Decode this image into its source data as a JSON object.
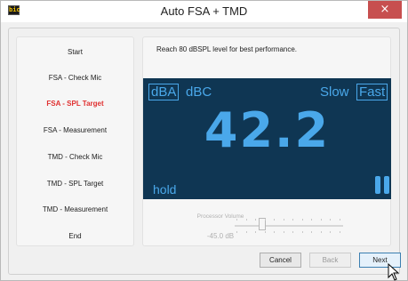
{
  "window": {
    "title": "Auto FSA + TMD",
    "app_icon_text": "bic",
    "close_label": "×"
  },
  "steps": [
    {
      "label": "Start",
      "active": false
    },
    {
      "label": "FSA - Check Mic",
      "active": false
    },
    {
      "label": "FSA - SPL Target",
      "active": true
    },
    {
      "label": "FSA - Measurement",
      "active": false
    },
    {
      "label": "TMD - Check Mic",
      "active": false
    },
    {
      "label": "TMD - SPL Target",
      "active": false
    },
    {
      "label": "TMD - Measurement",
      "active": false
    },
    {
      "label": "End",
      "active": false
    }
  ],
  "instruction": "Reach 80 dBSPL level for best performance.",
  "meter": {
    "weighting_a": "dBA",
    "weighting_c": "dBC",
    "weighting_selected": "dBA",
    "speed_slow": "Slow",
    "speed_fast": "Fast",
    "speed_selected": "Fast",
    "reading": "42.2",
    "hold_label": "hold"
  },
  "volume": {
    "label": "Processor Volume",
    "value": "-45.0 dB",
    "level_fraction": 0.25,
    "enabled": false
  },
  "buttons": {
    "cancel": "Cancel",
    "back": "Back",
    "next": "Next"
  },
  "colors": {
    "meter_bg": "#0f3653",
    "meter_fg": "#4aa8ea",
    "active_step": "#e03030",
    "close": "#c74f4f"
  }
}
